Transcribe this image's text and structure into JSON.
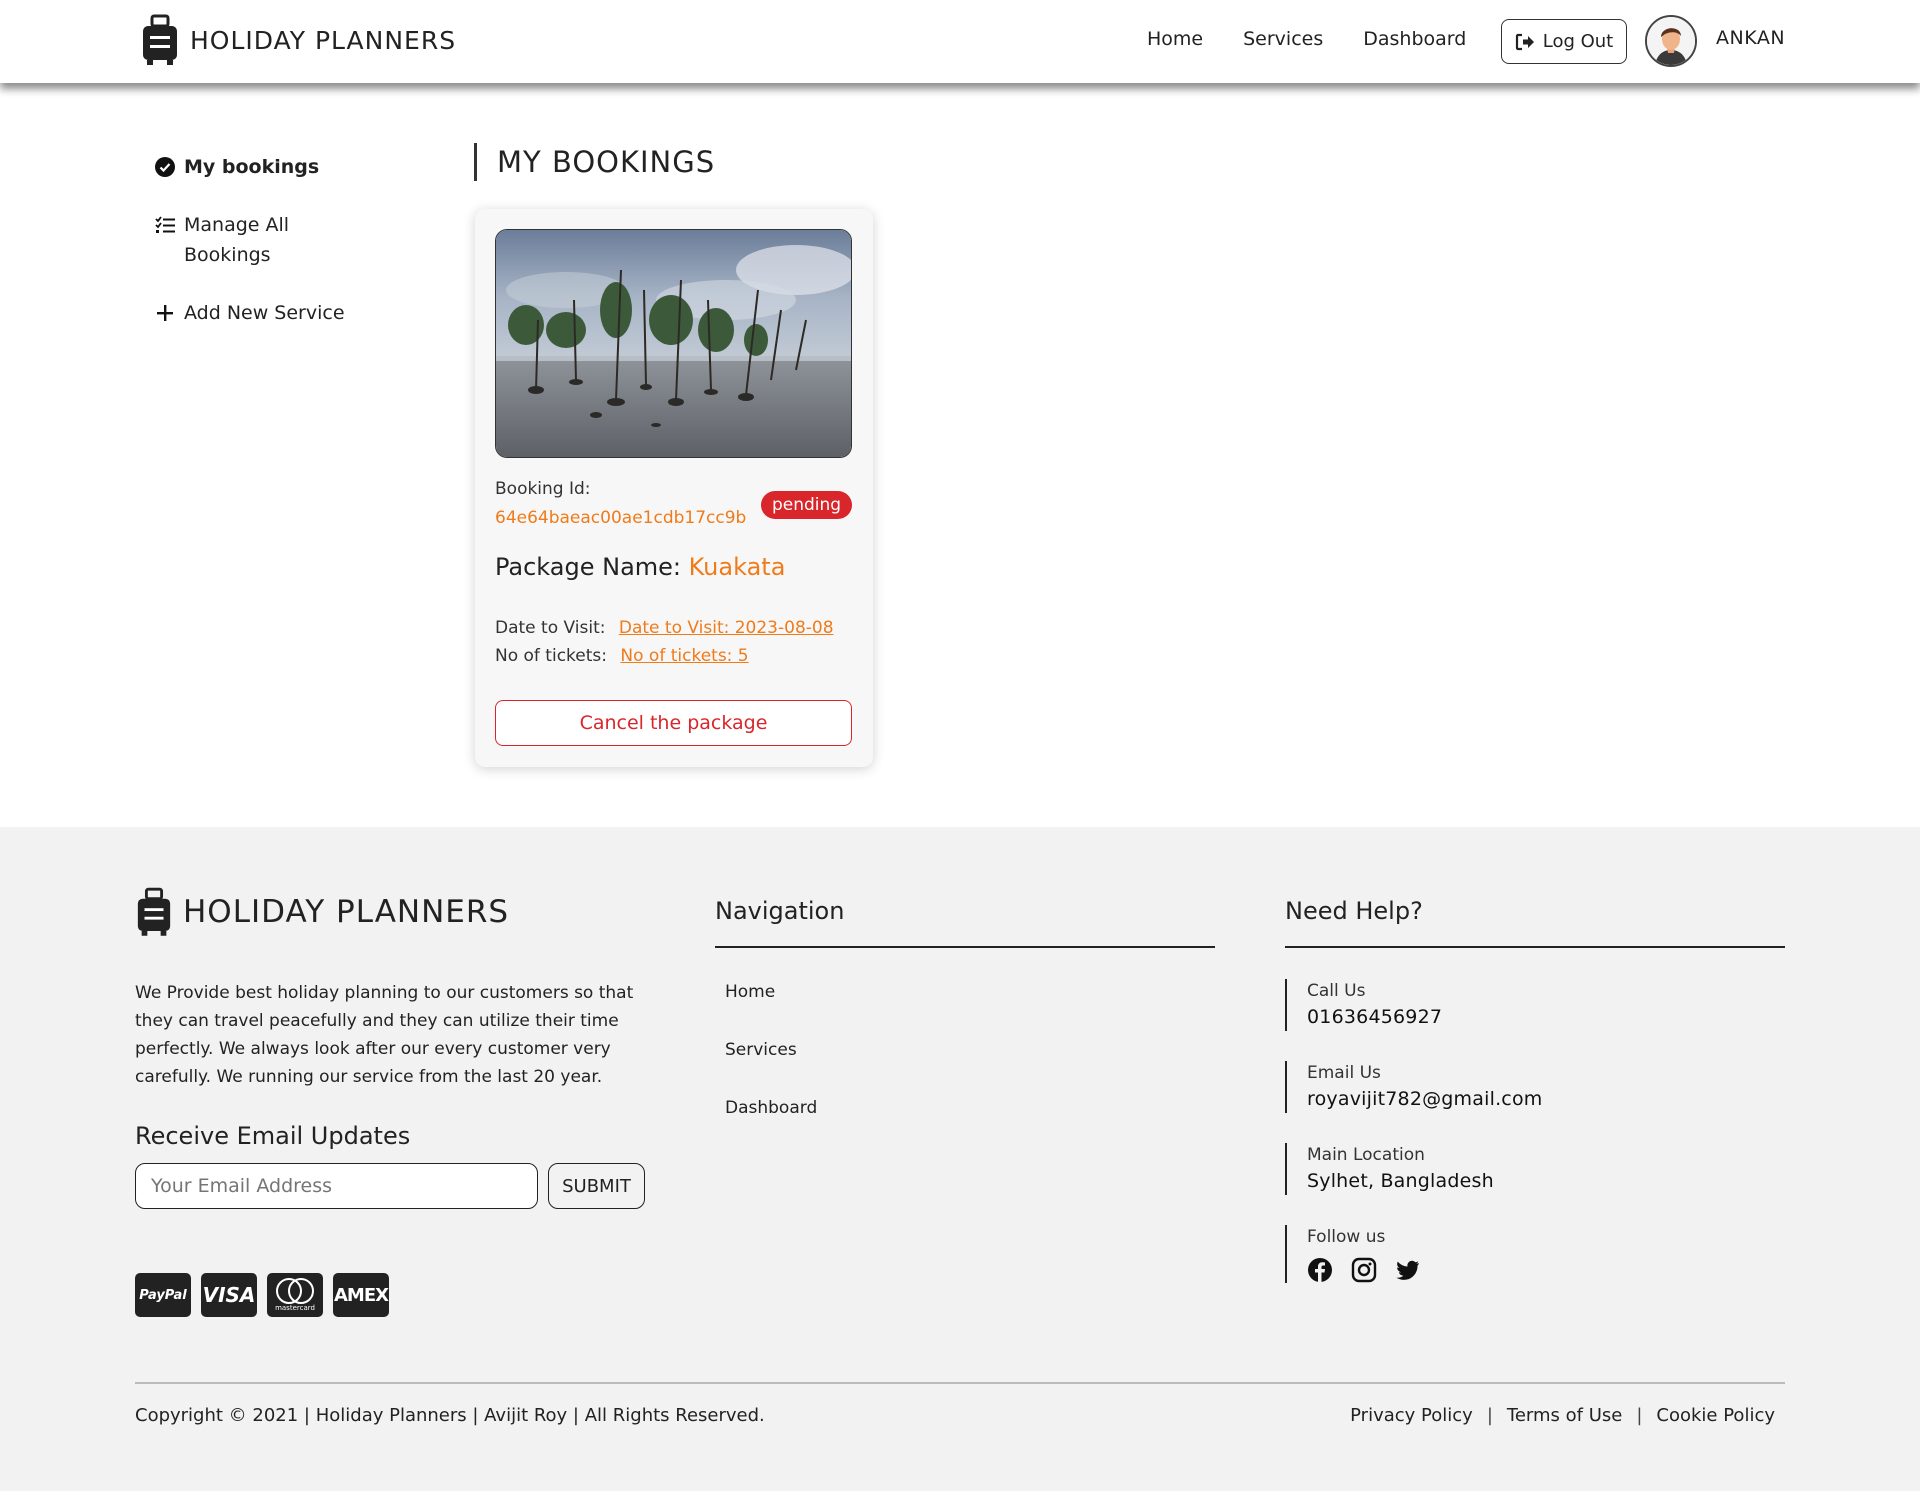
{
  "header": {
    "brand": "HOLIDAY PLANNERS",
    "nav": [
      "Home",
      "Services",
      "Dashboard"
    ],
    "logout_label": "Log Out",
    "username": "ANKAN"
  },
  "sidebar": {
    "items": [
      {
        "label": "My bookings",
        "icon": "check-circle-icon"
      },
      {
        "label": "Manage All Bookings",
        "icon": "checklist-icon"
      },
      {
        "label": "Add New Service",
        "icon": "plus-icon"
      }
    ]
  },
  "main": {
    "title": "MY BOOKINGS",
    "booking": {
      "id_label": "Booking Id:",
      "id_value": "64e64baeac00ae1cdb17cc9b",
      "status": "pending",
      "package_label": "Package Name:",
      "package_name": "Kuakata",
      "date_label": "Date to Visit:",
      "date_link": "Date to Visit: 2023-08-08",
      "tickets_label": "No of tickets:",
      "tickets_link": "No of tickets: 5",
      "cancel_label": "Cancel the package"
    }
  },
  "footer": {
    "brand": "HOLIDAY PLANNERS",
    "description": "We Provide best holiday planning to our customers so that they can travel peacefully and they can utilize their time perfectly. We always look after our every customer very carefully. We running our service from the last 20 year.",
    "email_title": "Receive Email Updates",
    "email_placeholder": "Your Email Address",
    "submit_label": "SUBMIT",
    "payments": [
      "PayPal",
      "VISA",
      "mastercard",
      "AMEX"
    ],
    "nav_title": "Navigation",
    "nav_items": [
      "Home",
      "Services",
      "Dashboard"
    ],
    "help_title": "Need Help?",
    "call_label": "Call Us",
    "call_value": "01636456927",
    "email_label": "Email Us",
    "email_value": "royavijit782@gmail.com",
    "location_label": "Main Location",
    "location_value": "Sylhet, Bangladesh",
    "follow_label": "Follow us",
    "copyright": "Copyright © 2021 | Holiday Planners | Avijit Roy | All Rights Reserved.",
    "legal": [
      "Privacy Policy",
      "Terms of Use",
      "Cookie Policy"
    ]
  },
  "colors": {
    "accent": "#f07b1a",
    "danger": "#d9262b",
    "footer_bg": "#f2f2f2"
  }
}
